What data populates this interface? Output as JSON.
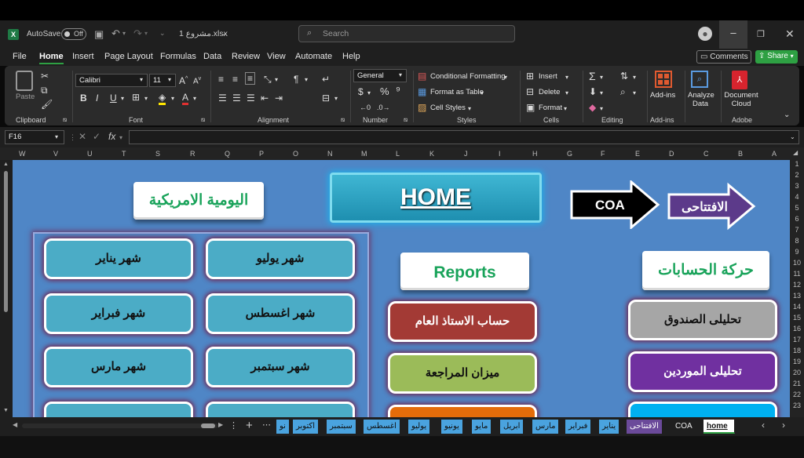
{
  "titlebar": {
    "autosave_label": "AutoSave",
    "autosave_state": "Off",
    "filename": "مشروع 1.xlsx",
    "search_placeholder": "Search"
  },
  "menu_tabs": [
    "File",
    "Home",
    "Insert",
    "Page Layout",
    "Formulas",
    "Data",
    "Review",
    "View",
    "Automate",
    "Help"
  ],
  "active_tab": "Home",
  "actions": {
    "comments": "Comments",
    "share": "Share"
  },
  "ribbon": {
    "clipboard": {
      "paste": "Paste",
      "group": "Clipboard"
    },
    "font": {
      "name": "Calibri",
      "size": "11",
      "group": "Font"
    },
    "alignment": {
      "group": "Alignment"
    },
    "number": {
      "format": "General",
      "group": "Number"
    },
    "styles": {
      "conditional": "Conditional Formatting",
      "table": "Format as Table",
      "cell": "Cell Styles",
      "group": "Styles"
    },
    "cells": {
      "insert": "Insert",
      "delete": "Delete",
      "format": "Format",
      "group": "Cells"
    },
    "editing": {
      "group": "Editing"
    },
    "addins": {
      "label": "Add-ins",
      "group": "Add-ins"
    },
    "analyze": {
      "label": "Analyze Data"
    },
    "adobe": {
      "label": "Document Cloud",
      "group": "Adobe"
    }
  },
  "formula_bar": {
    "name_box": "F16",
    "fx": "fx",
    "value": ""
  },
  "columns": [
    "W",
    "V",
    "U",
    "T",
    "S",
    "R",
    "Q",
    "P",
    "O",
    "N",
    "M",
    "L",
    "K",
    "J",
    "I",
    "H",
    "G",
    "F",
    "E",
    "D",
    "C",
    "B",
    "A"
  ],
  "rows": [
    "1",
    "2",
    "3",
    "4",
    "5",
    "6",
    "7",
    "8",
    "9",
    "10",
    "11",
    "12",
    "13",
    "14",
    "15",
    "16",
    "17",
    "18",
    "19",
    "20",
    "21",
    "22",
    "23"
  ],
  "sheet": {
    "home_title": "HOME",
    "coa_arrow": "COA",
    "opening_arrow": "الافتتاحى",
    "journal_title": "اليومية الامريكية",
    "reports_title": "Reports",
    "movement_title": "حركة الحسابات",
    "month_buttons": [
      "شهر يناير",
      "شهر يوليو",
      "شهر فبراير",
      "شهر اغسطس",
      "شهر مارس",
      "شهر سبتمبر"
    ],
    "report_buttons": [
      "حساب الاستاذ العام",
      "ميزان المراجعة"
    ],
    "movement_buttons": [
      "تحليلى الصندوق",
      "تحليلى الموردين"
    ],
    "colors": {
      "report1": "#a33a35",
      "report2": "#9bbb59",
      "report3": "#e46c0a",
      "move1": "#a6a6a6",
      "move2": "#7030a0",
      "move3": "#00b0f0",
      "month": "#4bacc6"
    }
  },
  "sheet_tabs": [
    "home",
    "COA",
    "الافتتاحى",
    "يناير",
    "فبراير",
    "مارس",
    "ابريل",
    "مايو",
    "يونيو",
    "يوليو",
    "اغسطس",
    "سبتمبر",
    "اكتوبر",
    "نو"
  ],
  "active_sheet": "home"
}
